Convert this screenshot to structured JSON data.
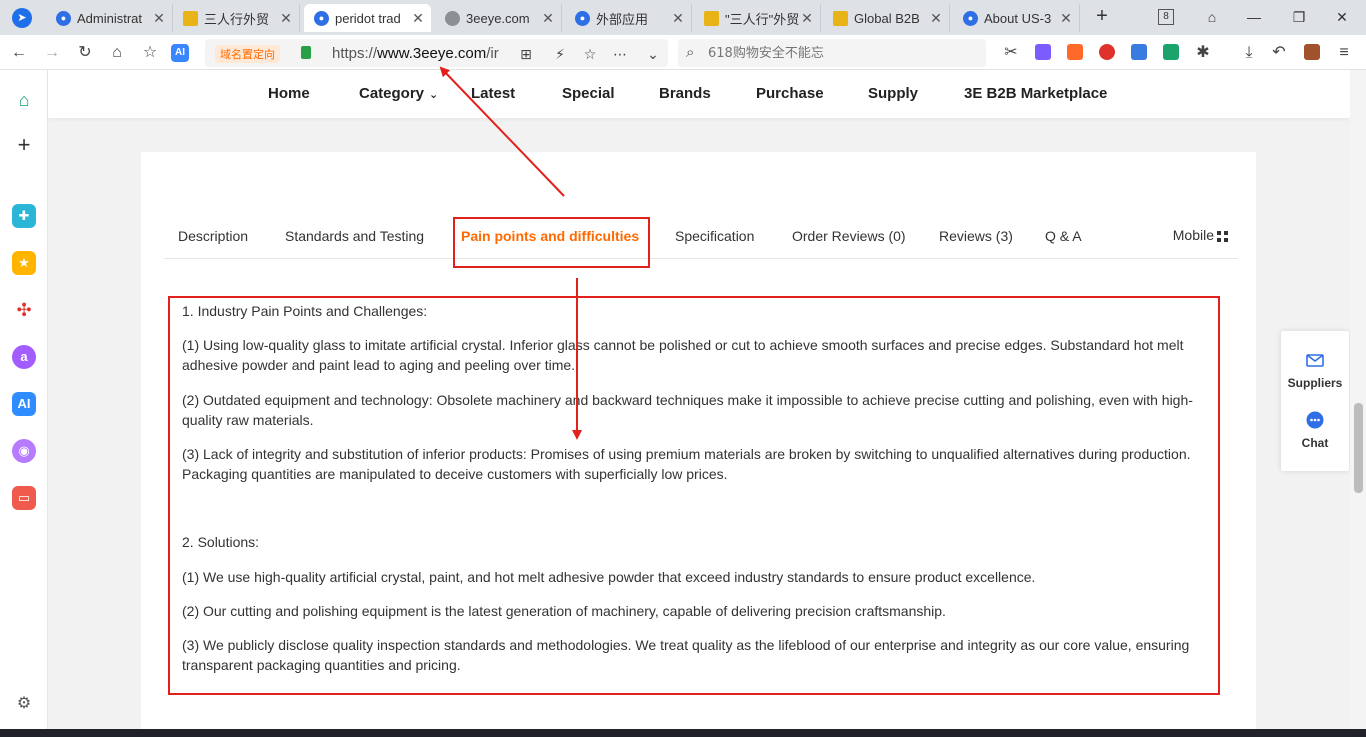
{
  "tabs": [
    {
      "label": "Administrat",
      "favicon": "eye-favicon"
    },
    {
      "label": "三人行外贸",
      "favicon": "gold-favicon"
    },
    {
      "label": "peridot trad",
      "favicon": "eye-favicon",
      "active": true
    },
    {
      "label": "3eeye.com",
      "favicon": "globe-favicon"
    },
    {
      "label": "外部应用",
      "favicon": "eye-favicon"
    },
    {
      "label": "\"三人行\"外贸",
      "favicon": "gold-favicon"
    },
    {
      "label": "Global B2B",
      "favicon": "gold-favicon"
    },
    {
      "label": "About US-3",
      "favicon": "eye-favicon"
    }
  ],
  "window": {
    "tab_count": "8"
  },
  "address_bar": {
    "domain_tag": "域名置定向",
    "url_prefix": "https://",
    "url_host": "www.3eeye.com",
    "url_rest": "/ir",
    "search_placeholder": "618购物安全不能忘"
  },
  "site_nav": {
    "home": "Home",
    "category": "Category",
    "latest": "Latest",
    "special": "Special",
    "brands": "Brands",
    "purchase": "Purchase",
    "supply": "Supply",
    "marketplace": "3E B2B Marketplace"
  },
  "product_tabs": {
    "description": "Description",
    "standards": "Standards and Testing",
    "pain_points": "Pain points and difficulties",
    "specification": "Specification",
    "order_reviews": "Order Reviews (0)",
    "reviews": "Reviews (3)",
    "qa": "Q & A",
    "mobile": "Mobile"
  },
  "content": {
    "heading1": "1. Industry Pain Points and Challenges:",
    "p1": "(1) Using low-quality glass to imitate artificial crystal. Inferior glass cannot be polished or cut to achieve smooth surfaces and precise edges. Substandard hot melt adhesive powder and paint lead to aging and peeling over time.",
    "p2": "(2) Outdated equipment and technology: Obsolete machinery and backward techniques make it impossible to achieve precise cutting and polishing, even with high-quality raw materials.",
    "p3": "(3) Lack of integrity and substitution of inferior products: Promises of using premium materials are broken by switching to unqualified alternatives during production. Packaging quantities are manipulated to deceive customers with superficially low prices.",
    "heading2": "2. Solutions:",
    "s1": "(1) We use high-quality artificial crystal, paint, and hot melt adhesive powder that exceed industry standards to ensure product excellence.",
    "s2": "(2) Our cutting and polishing equipment is the latest generation of machinery, capable of delivering precision craftsmanship.",
    "s3": "(3) We publicly disclose quality inspection standards and methodologies. We treat quality as the lifeblood of our enterprise and integrity as our core value, ensuring transparent packaging quantities and pricing."
  },
  "float_widget": {
    "suppliers": "Suppliers",
    "chat": "Chat"
  },
  "colors": {
    "accent": "#ff6a00",
    "annotation_red": "#e2211c",
    "brand_blue": "#2f6fe6"
  }
}
